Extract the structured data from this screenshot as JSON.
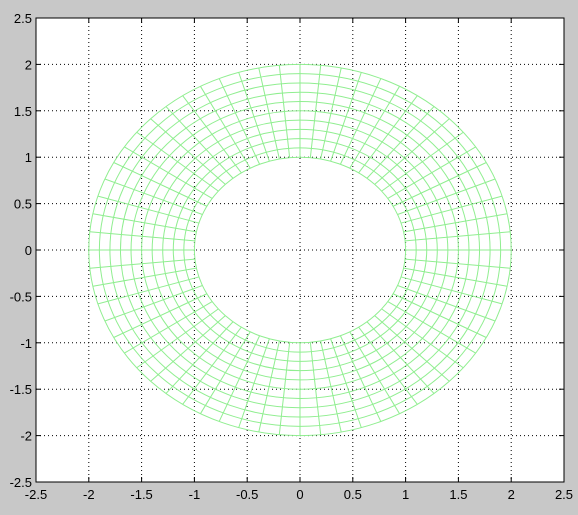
{
  "chart_data": {
    "type": "mesh",
    "title": "",
    "xlabel": "",
    "ylabel": "",
    "xlim": [
      -2.5,
      2.5
    ],
    "ylim": [
      -2.5,
      2.5
    ],
    "xticks": [
      "-2.5",
      "-2",
      "-1.5",
      "-1",
      "-0.5",
      "0",
      "0.5",
      "1",
      "1.5",
      "2",
      "2.5"
    ],
    "yticks": [
      "-2.5",
      "-2",
      "-1.5",
      "-1",
      "-0.5",
      "0",
      "0.5",
      "1",
      "1.5",
      "2",
      "2.5"
    ],
    "grid": true,
    "grid_style": "dotted",
    "annulus": {
      "center": [
        0,
        0
      ],
      "inner_radius": 1,
      "outer_radius": 2,
      "radial_divisions": 10,
      "angular_divisions": 64
    },
    "colors": {
      "mesh": "#90ee90",
      "background": "#ffffff",
      "figure_background": "#c8c8c8",
      "axes": "#000000",
      "grid": "#000000"
    }
  }
}
